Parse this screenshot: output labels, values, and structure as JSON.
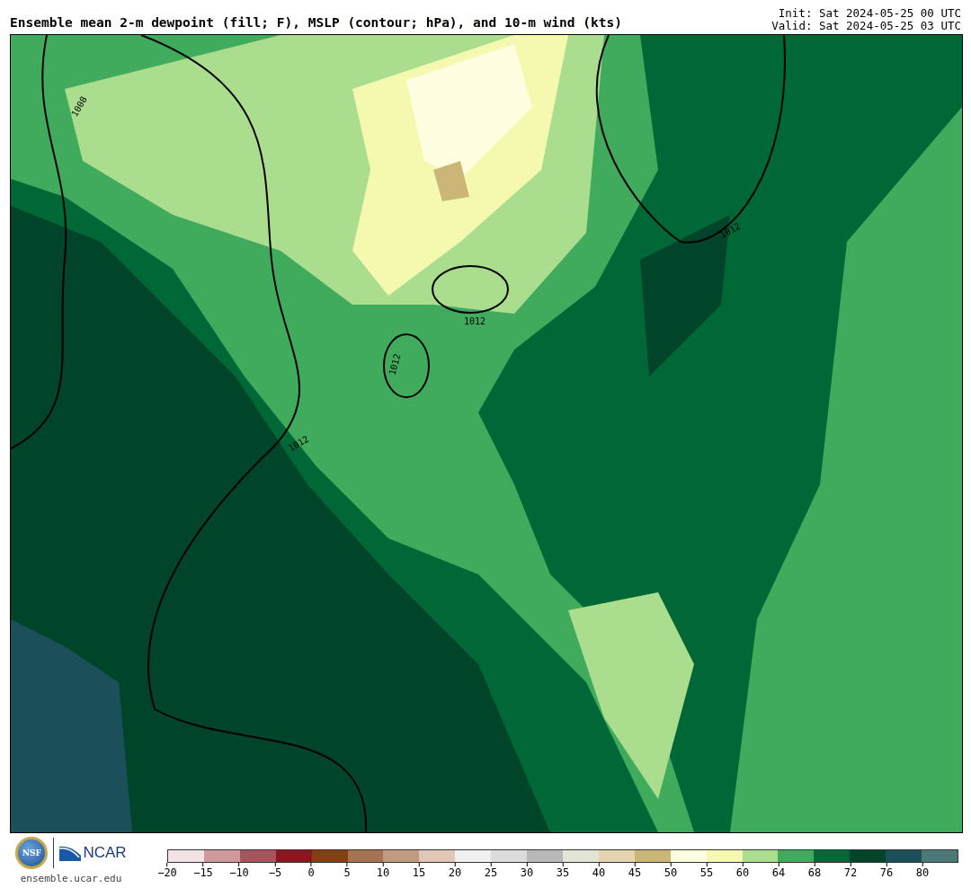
{
  "header": {
    "title": "Ensemble mean 2-m dewpoint (fill; F), MSLP (contour; hPa), and 10-m wind (kts)",
    "init": "Init: Sat 2024-05-25 00 UTC",
    "valid": "Valid: Sat 2024-05-25 03 UTC"
  },
  "map": {
    "contour_labels": [
      "1008",
      "1012",
      "1012",
      "1012",
      "1012"
    ]
  },
  "footer": {
    "nsf_logo_text": "NSF",
    "ncar_logo_text": "NCAR",
    "url": "ensemble.ucar.edu"
  },
  "legend": {
    "bins": [
      {
        "color": "#f2e4e4"
      },
      {
        "color": "#d0999d"
      },
      {
        "color": "#a8545c"
      },
      {
        "color": "#8b1520"
      },
      {
        "color": "#843f12"
      },
      {
        "color": "#a67352"
      },
      {
        "color": "#c29a80"
      },
      {
        "color": "#e0c7b6"
      },
      {
        "color": "#f0f0f0"
      },
      {
        "color": "#dcdcdc"
      },
      {
        "color": "#b8b8b8"
      },
      {
        "color": "#e2e4d6"
      },
      {
        "color": "#e6d4b0"
      },
      {
        "color": "#cbb677"
      },
      {
        "color": "#fefee0"
      },
      {
        "color": "#f5f9b0"
      },
      {
        "color": "#abdd8e"
      },
      {
        "color": "#41ab5d"
      },
      {
        "color": "#006837"
      },
      {
        "color": "#00452a"
      },
      {
        "color": "#1b4f5a"
      },
      {
        "color": "#4c7878"
      }
    ],
    "ticks": [
      "−20",
      "−15",
      "−10",
      "−5",
      "0",
      "5",
      "10",
      "15",
      "20",
      "25",
      "30",
      "35",
      "40",
      "45",
      "50",
      "55",
      "60",
      "64",
      "68",
      "72",
      "76",
      "80"
    ]
  }
}
